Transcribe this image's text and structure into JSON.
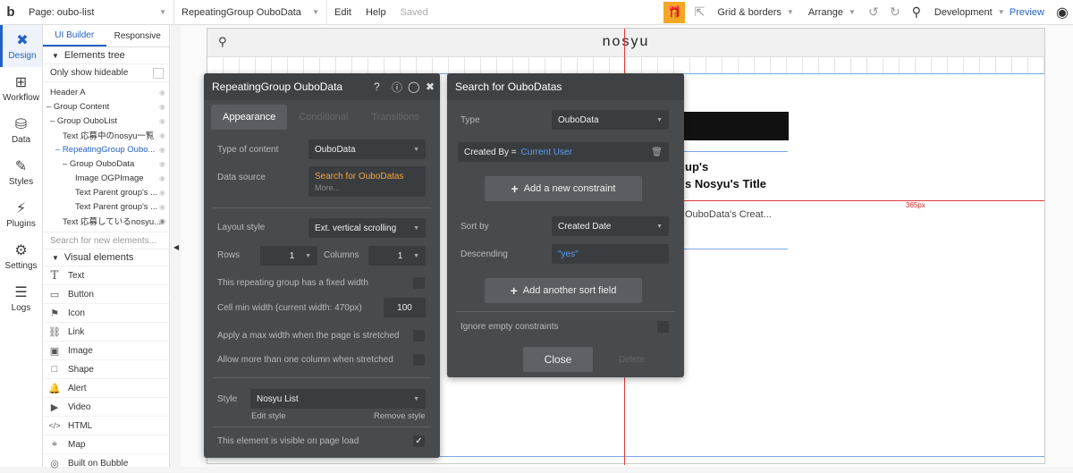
{
  "topbar": {
    "logo": "b",
    "page_select": "Page: oubo-list",
    "element_select": "RepeatingGroup OuboData",
    "edit": "Edit",
    "help": "Help",
    "saved": "Saved",
    "grid": "Grid & borders",
    "arrange": "Arrange",
    "env": "Development",
    "preview": "Preview"
  },
  "leftnav": [
    {
      "label": "Design",
      "icon": "design-icon"
    },
    {
      "label": "Workflow",
      "icon": "workflow-icon"
    },
    {
      "label": "Data",
      "icon": "data-icon"
    },
    {
      "label": "Styles",
      "icon": "styles-icon"
    },
    {
      "label": "Plugins",
      "icon": "plugins-icon"
    },
    {
      "label": "Settings",
      "icon": "settings-icon"
    },
    {
      "label": "Logs",
      "icon": "logs-icon"
    }
  ],
  "leftpanel": {
    "tab_builder": "UI Builder",
    "tab_responsive": "Responsive",
    "tree_title": "Elements tree",
    "only_hideable": "Only show hideable",
    "tree": [
      "Header A",
      "– Group Content",
      "– Group OuboList",
      "Text 応募中のnosyu一覧",
      "– RepeatingGroup Oubo...",
      "– Group OuboData",
      "Image OGPImage",
      "Text Parent group's ...",
      "Text Parent group's ...",
      "Text 応募しているnosyu..."
    ],
    "search_placeholder": "Search for new elements...",
    "visual_title": "Visual elements",
    "visual": [
      {
        "label": "Text",
        "icon": "T"
      },
      {
        "label": "Button",
        "icon": "▭"
      },
      {
        "label": "Icon",
        "icon": "⚑"
      },
      {
        "label": "Link",
        "icon": "⛓"
      },
      {
        "label": "Image",
        "icon": "▣"
      },
      {
        "label": "Shape",
        "icon": "□"
      },
      {
        "label": "Alert",
        "icon": "🔔"
      },
      {
        "label": "Video",
        "icon": "▶"
      },
      {
        "label": "HTML",
        "icon": "</>"
      },
      {
        "label": "Map",
        "icon": "⌖"
      },
      {
        "label": "Built on Bubble",
        "icon": "◎"
      }
    ]
  },
  "canvas": {
    "brand": "nosyu",
    "text1": "up's",
    "text2": "s Nosyu's Title",
    "text3": "OuboData's Creat...",
    "dimension": "365px"
  },
  "rg_panel": {
    "title": "RepeatingGroup OuboData",
    "tabs": [
      "Appearance",
      "Conditional",
      "Transitions"
    ],
    "type_label": "Type of content",
    "type_value": "OuboData",
    "source_label": "Data source",
    "source_value": "Search for OuboDatas",
    "more": "More...",
    "layout_label": "Layout style",
    "layout_value": "Ext. vertical scrolling",
    "rows_label": "Rows",
    "rows_value": "1",
    "cols_label": "Columns",
    "cols_value": "1",
    "fixed_width": "This repeating group has a fixed width",
    "cell_min": "Cell min width (current width: 470px)",
    "cell_min_value": "100",
    "max_width": "Apply a max width when the page is stretched",
    "more_cols": "Allow more than one column when stretched",
    "style_label": "Style",
    "style_value": "Nosyu List",
    "edit_style": "Edit style",
    "remove_style": "Remove style",
    "visible": "This element is visible on page load"
  },
  "search_panel": {
    "title": "Search for OuboDatas",
    "type_label": "Type",
    "type_value": "OuboData",
    "constraint_key": "Created By =",
    "constraint_value": "Current User",
    "add_constraint": "Add a new constraint",
    "sort_label": "Sort by",
    "sort_value": "Created Date",
    "desc_label": "Descending",
    "desc_value": "\"yes\"",
    "add_sort": "Add another sort field",
    "ignore_empty": "Ignore empty constraints",
    "close": "Close",
    "delete": "Delete"
  }
}
